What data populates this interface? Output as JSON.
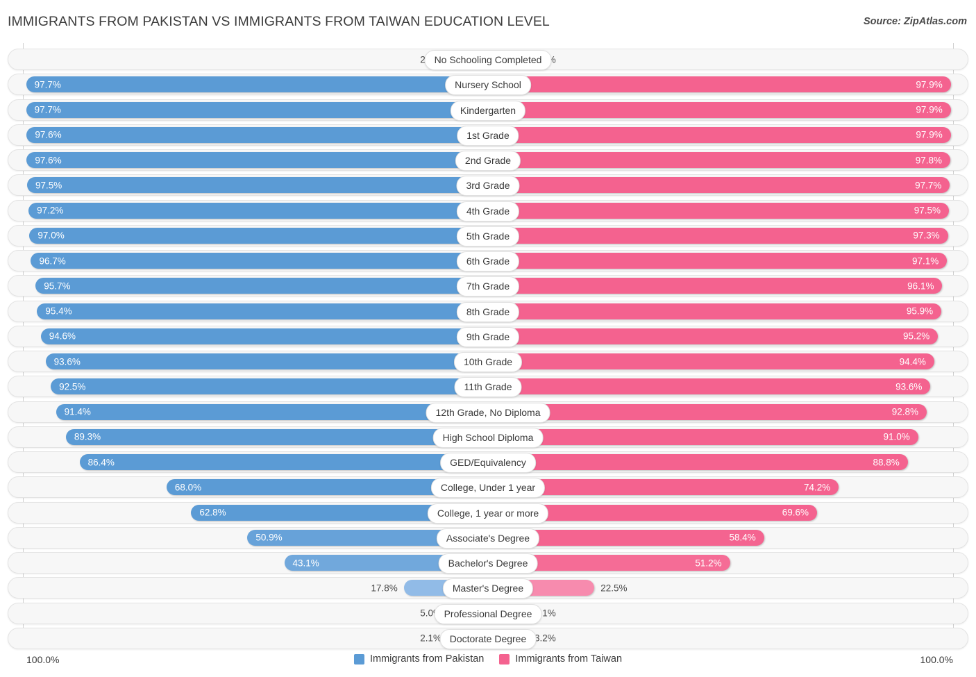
{
  "header": {
    "title": "IMMIGRANTS FROM PAKISTAN VS IMMIGRANTS FROM TAIWAN EDUCATION LEVEL",
    "source": "Source: ZipAtlas.com"
  },
  "footer": {
    "axis_max_left": "100.0%",
    "axis_max_right": "100.0%",
    "legend": [
      {
        "label": "Immigrants from Pakistan",
        "color": "#5b9bd5"
      },
      {
        "label": "Immigrants from Taiwan",
        "color": "#f4628f"
      }
    ]
  },
  "colors": {
    "left_strong": "#5b9bd5",
    "left_light": "#a8c8ee",
    "right_strong": "#f4628f",
    "right_light": "#f9a3c0",
    "track": "#f7f7f7",
    "track_border": "#e3e3e3",
    "axis": "#d0d0d0"
  },
  "chart_data": {
    "type": "bar",
    "orientation": "horizontal-diverging",
    "title": "IMMIGRANTS FROM PAKISTAN VS IMMIGRANTS FROM TAIWAN EDUCATION LEVEL",
    "xlabel": "",
    "ylabel": "",
    "xlim": [
      0,
      100
    ],
    "grid": false,
    "legend_position": "bottom-center",
    "categories": [
      "No Schooling Completed",
      "Nursery School",
      "Kindergarten",
      "1st Grade",
      "2nd Grade",
      "3rd Grade",
      "4th Grade",
      "5th Grade",
      "6th Grade",
      "7th Grade",
      "8th Grade",
      "9th Grade",
      "10th Grade",
      "11th Grade",
      "12th Grade, No Diploma",
      "High School Diploma",
      "GED/Equivalency",
      "College, Under 1 year",
      "College, 1 year or more",
      "Associate's Degree",
      "Bachelor's Degree",
      "Master's Degree",
      "Professional Degree",
      "Doctorate Degree"
    ],
    "series": [
      {
        "name": "Immigrants from Pakistan",
        "color": "#5b9bd5",
        "side": "left",
        "values": [
          2.3,
          97.7,
          97.7,
          97.6,
          97.6,
          97.5,
          97.2,
          97.0,
          96.7,
          95.7,
          95.4,
          94.6,
          93.6,
          92.5,
          91.4,
          89.3,
          86.4,
          68.0,
          62.8,
          50.9,
          43.1,
          17.8,
          5.0,
          2.1
        ],
        "labels": [
          "2.3%",
          "97.7%",
          "97.7%",
          "97.6%",
          "97.6%",
          "97.5%",
          "97.2%",
          "97.0%",
          "96.7%",
          "95.7%",
          "95.4%",
          "94.6%",
          "93.6%",
          "92.5%",
          "91.4%",
          "89.3%",
          "86.4%",
          "68.0%",
          "62.8%",
          "50.9%",
          "43.1%",
          "17.8%",
          "5.0%",
          "2.1%"
        ]
      },
      {
        "name": "Immigrants from Taiwan",
        "color": "#f4628f",
        "side": "right",
        "values": [
          2.1,
          97.9,
          97.9,
          97.9,
          97.8,
          97.7,
          97.5,
          97.3,
          97.1,
          96.1,
          95.9,
          95.2,
          94.4,
          93.6,
          92.8,
          91.0,
          88.8,
          74.2,
          69.6,
          58.4,
          51.2,
          22.5,
          7.1,
          3.2
        ],
        "labels": [
          "2.1%",
          "97.9%",
          "97.9%",
          "97.9%",
          "97.8%",
          "97.7%",
          "97.5%",
          "97.3%",
          "97.1%",
          "96.1%",
          "95.9%",
          "95.2%",
          "94.4%",
          "93.6%",
          "92.8%",
          "91.0%",
          "88.8%",
          "74.2%",
          "69.6%",
          "58.4%",
          "51.2%",
          "22.5%",
          "7.1%",
          "3.2%"
        ]
      }
    ]
  }
}
